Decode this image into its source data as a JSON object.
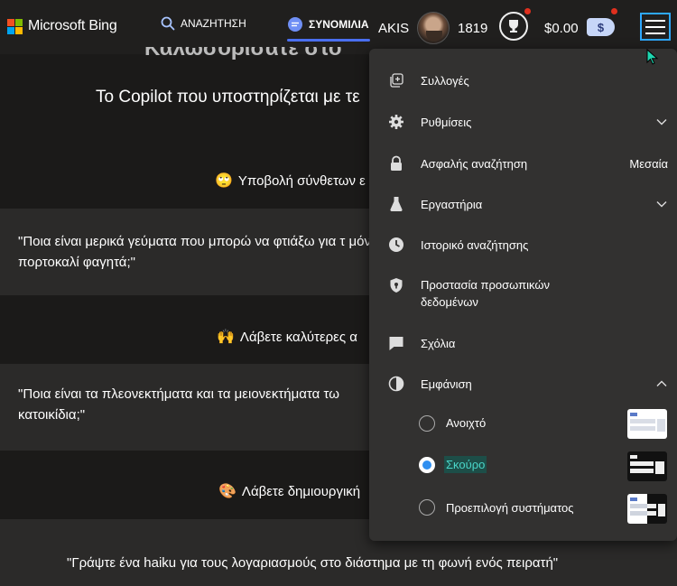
{
  "header": {
    "brand": "Microsoft Bing",
    "search_label": "ΑΝΑΖΗΤΗΣΗ",
    "chat_label": "ΣΥΝΟΜΙΛΙΑ",
    "user_name": "AKIS",
    "points": "1819",
    "money": "$0.00",
    "money_symbol": "$",
    "accent_color": "#4a6ff0"
  },
  "main": {
    "welcome_partial": "Καλωσορίσατε στο",
    "subtitle": "Το Copilot που υποστηρίζεται με τε",
    "features": [
      {
        "emoji": "🙄",
        "title": "Υποβολή σύνθετων ε",
        "example": "\"Ποια είναι μερικά γεύματα που μπορώ να φτιάξω για τ μόνο πορτοκαλί φαγητά;\""
      },
      {
        "emoji": "🙌",
        "title": "Λάβετε καλύτερες α",
        "example": "\"Ποια είναι τα πλεονεκτήματα και τα μειονεκτήματα τω κατοικίδια;\""
      },
      {
        "emoji": "🎨",
        "title": "Λάβετε δημιουργική",
        "example": "\"Γράψτε ένα haiku για τους λογαριασμούς στο διάστημα με τη φωνή ενός πειρατή\""
      }
    ]
  },
  "menu": {
    "items": [
      {
        "label": "Συλλογές",
        "icon": "collections-icon"
      },
      {
        "label": "Ρυθμίσεις",
        "icon": "gear-icon"
      },
      {
        "label": "Ασφαλής αναζήτηση",
        "icon": "lock-icon",
        "value": "Μεσαία"
      },
      {
        "label": "Εργαστήρια",
        "icon": "flask-icon"
      },
      {
        "label": "Ιστορικό αναζήτησης",
        "icon": "history-icon"
      },
      {
        "label": "Προστασία προσωπικών δεδομένων",
        "icon": "shield-icon"
      },
      {
        "label": "Σχόλια",
        "icon": "feedback-icon"
      },
      {
        "label": "Εμφάνιση",
        "icon": "contrast-icon"
      }
    ],
    "appearance_options": [
      {
        "label": "Ανοιχτό",
        "selected": false
      },
      {
        "label": "Σκούρο",
        "selected": true
      },
      {
        "label": "Προεπιλογή συστήματος",
        "selected": false
      }
    ]
  }
}
